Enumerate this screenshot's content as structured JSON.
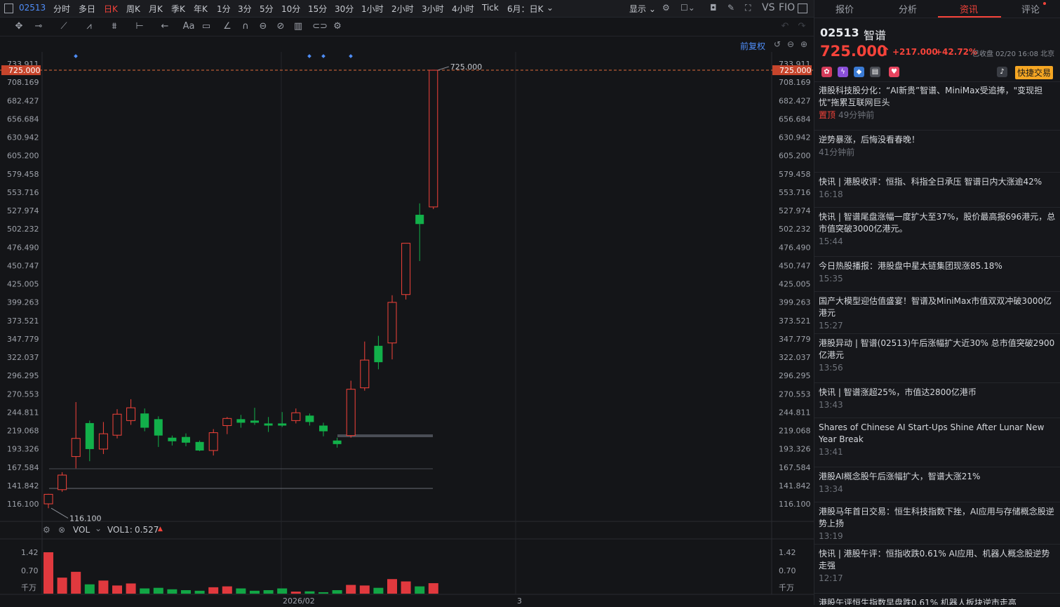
{
  "topbar": {
    "code": "02513",
    "periods": [
      "分时",
      "多日",
      "日K",
      "周K",
      "月K",
      "季K",
      "年K",
      "1分",
      "3分",
      "5分",
      "10分",
      "15分",
      "30分",
      "1小时",
      "2小时",
      "3小时",
      "4小时",
      "Tick",
      "6月：日K"
    ],
    "active_period": "日K",
    "display_label": "显示",
    "vs_label": "VS",
    "f10_label": "FIO"
  },
  "chart_header": {
    "adjust_label": "前复权"
  },
  "price_axis": {
    "ticks": [
      "733.911",
      "708.169",
      "682.427",
      "656.684",
      "630.942",
      "605.200",
      "579.458",
      "553.716",
      "527.974",
      "502.232",
      "476.490",
      "450.747",
      "425.005",
      "399.263",
      "373.521",
      "347.779",
      "322.037",
      "296.295",
      "270.553",
      "244.811",
      "219.068",
      "193.326",
      "167.584",
      "141.842",
      "116.100"
    ],
    "current_price_tag": "725.000",
    "max_label": "725.000",
    "min_label": "116.100"
  },
  "volume": {
    "indicator_label": "VOL",
    "vol1_label": "VOL1:",
    "vol1_value": "0.527",
    "ticks": [
      "1.42",
      "0.70",
      "千万"
    ]
  },
  "date_axis": {
    "labels": [
      "2026/02",
      "3"
    ]
  },
  "chart_data": {
    "type": "candlestick",
    "series": [
      {
        "o": 116.1,
        "h": 130.2,
        "l": 110.0,
        "c": 129.5,
        "up": true
      },
      {
        "o": 136.0,
        "h": 160.5,
        "l": 133.0,
        "c": 156.5,
        "up": true
      },
      {
        "o": 182.5,
        "h": 259.0,
        "l": 166.0,
        "c": 208.0,
        "up": true
      },
      {
        "o": 229.5,
        "h": 233.0,
        "l": 176.0,
        "c": 193.0,
        "up": false
      },
      {
        "o": 193.0,
        "h": 231.0,
        "l": 186.0,
        "c": 214.5,
        "up": true
      },
      {
        "o": 212.5,
        "h": 249.0,
        "l": 208.0,
        "c": 242.0,
        "up": true
      },
      {
        "o": 233.0,
        "h": 263.0,
        "l": 227.0,
        "c": 251.0,
        "up": true
      },
      {
        "o": 243.0,
        "h": 250.0,
        "l": 218.0,
        "c": 223.0,
        "up": false
      },
      {
        "o": 235.0,
        "h": 239.0,
        "l": 196.0,
        "c": 212.0,
        "up": false
      },
      {
        "o": 209.0,
        "h": 212.0,
        "l": 198.0,
        "c": 204.0,
        "up": false
      },
      {
        "o": 210.0,
        "h": 215.0,
        "l": 197.0,
        "c": 202.0,
        "up": false
      },
      {
        "o": 203.0,
        "h": 205.0,
        "l": 190.0,
        "c": 191.0,
        "up": false
      },
      {
        "o": 191.0,
        "h": 221.0,
        "l": 184.0,
        "c": 216.0,
        "up": true
      },
      {
        "o": 226.0,
        "h": 238.0,
        "l": 214.0,
        "c": 236.0,
        "up": true
      },
      {
        "o": 235.0,
        "h": 241.0,
        "l": 223.0,
        "c": 230.0,
        "up": false
      },
      {
        "o": 233.0,
        "h": 251.0,
        "l": 227.0,
        "c": 230.0,
        "up": false
      },
      {
        "o": 229.0,
        "h": 238.0,
        "l": 217.0,
        "c": 226.0,
        "up": false
      },
      {
        "o": 229.0,
        "h": 245.0,
        "l": 224.0,
        "c": 226.0,
        "up": false
      },
      {
        "o": 233.0,
        "h": 250.0,
        "l": 229.0,
        "c": 244.0,
        "up": true
      },
      {
        "o": 240.0,
        "h": 243.0,
        "l": 226.0,
        "c": 231.0,
        "up": false
      },
      {
        "o": 226.0,
        "h": 230.0,
        "l": 211.0,
        "c": 218.0,
        "up": false
      },
      {
        "o": 205.0,
        "h": 209.0,
        "l": 195.0,
        "c": 200.0,
        "up": false
      },
      {
        "o": 212.0,
        "h": 289.0,
        "l": 209.0,
        "c": 277.0,
        "up": true
      },
      {
        "o": 279.0,
        "h": 344.0,
        "l": 275.0,
        "c": 318.0,
        "up": true
      },
      {
        "o": 338.0,
        "h": 352.0,
        "l": 305.0,
        "c": 315.0,
        "up": false
      },
      {
        "o": 342.0,
        "h": 409.0,
        "l": 319.0,
        "c": 399.0,
        "up": true
      },
      {
        "o": 410.0,
        "h": 444.0,
        "l": 403.0,
        "c": 482.0,
        "up": true
      },
      {
        "o": 522.0,
        "h": 538.0,
        "l": 457.0,
        "c": 509.0,
        "up": false
      },
      {
        "o": 533.0,
        "h": 725.0,
        "l": 530.0,
        "c": 725.0,
        "up": true
      }
    ],
    "volume": [
      1.42,
      0.55,
      0.75,
      0.32,
      0.45,
      0.28,
      0.35,
      0.18,
      0.2,
      0.15,
      0.12,
      0.1,
      0.22,
      0.25,
      0.18,
      0.1,
      0.12,
      0.18,
      0.07,
      0.08,
      0.05,
      0.12,
      0.3,
      0.28,
      0.2,
      0.5,
      0.42,
      0.25,
      0.36
    ],
    "ylim": [
      116.1,
      733.911
    ],
    "vol_max": 1.42
  },
  "right_panel": {
    "tabs": [
      "报价",
      "分析",
      "资讯",
      "评论"
    ],
    "active_tab": "资讯",
    "stock_code": "02513",
    "stock_name": "智谱",
    "price": "725.000",
    "change": "+217.000",
    "change_pct": "+42.72%",
    "status": "已收盘 02/20 16:08 北京",
    "quick_trade": "快捷交易",
    "news": [
      {
        "title": "港股科技股分化：“AI新贵”智谱、MiniMax受追捧，\"变现担忧\"拖累互联网巨头",
        "time": "49分钟前",
        "pinned": "置顶"
      },
      {
        "title": "逆势暴涨，后悔没看春晚！",
        "time": "41分钟前"
      },
      {
        "title": "快讯 | 港股收评：恒指、科指全日承压 智谱日内大涨逾42%",
        "time": "16:18"
      },
      {
        "title": "快讯 | 智谱尾盘涨幅一度扩大至37%，股价最高报696港元，总市值突破3000亿港元。",
        "time": "15:44"
      },
      {
        "title": "今日热股播报：港股盘中星太链集团现涨85.18%",
        "time": "15:35"
      },
      {
        "title": "国产大模型迎估值盛宴！智谱及MiniMax市值双双冲破3000亿港元",
        "time": "15:27"
      },
      {
        "title": "港股异动 | 智谱(02513)午后涨幅扩大近30% 总市值突破2900亿港元",
        "time": "13:56"
      },
      {
        "title": "快讯 | 智谱涨超25%，市值达2800亿港币",
        "time": "13:43"
      },
      {
        "title": "Shares of Chinese AI Start-Ups Shine After Lunar New Year Break",
        "time": "13:41"
      },
      {
        "title": "港股AI概念股午后涨幅扩大，智谱大涨21%",
        "time": "13:34"
      },
      {
        "title": "港股马年首日交易：恒生科技指数下挫，AI应用与存储概念股逆势上扬",
        "time": "13:19"
      },
      {
        "title": "快讯 | 港股午评：恒指收跌0.61% AI应用、机器人概念股逆势走强",
        "time": "12:17"
      },
      {
        "title": "港股午评恒生指数早盘跌0.61% 机器人板块逆市走高",
        "time": ""
      }
    ]
  }
}
